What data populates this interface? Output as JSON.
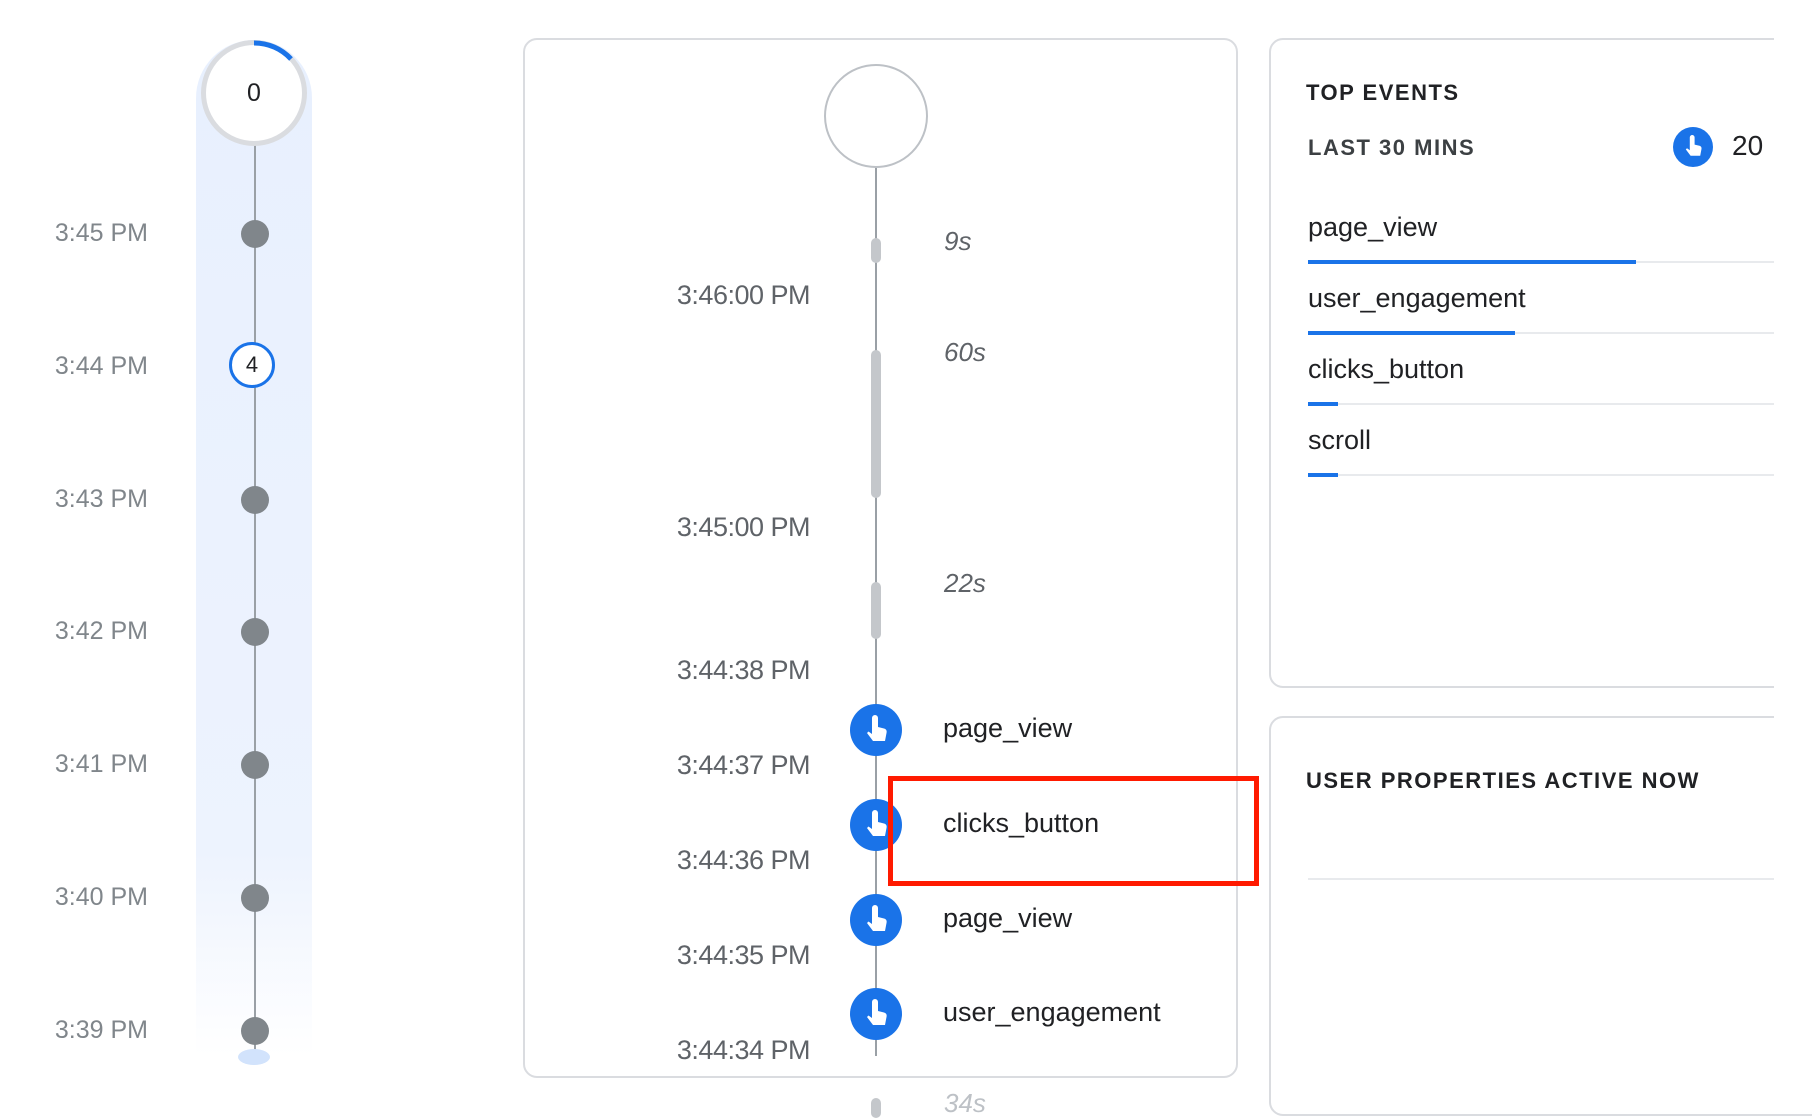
{
  "minute_timeline": {
    "current_count": "0",
    "rows": [
      {
        "time": "3:45 PM",
        "count": ""
      },
      {
        "time": "3:44 PM",
        "count": "4"
      },
      {
        "time": "3:43 PM",
        "count": ""
      },
      {
        "time": "3:42 PM",
        "count": ""
      },
      {
        "time": "3:41 PM",
        "count": ""
      },
      {
        "time": "3:40 PM",
        "count": ""
      },
      {
        "time": "3:39 PM",
        "count": ""
      }
    ]
  },
  "event_stream": {
    "gaps": [
      {
        "label": "9s"
      },
      {
        "label": "60s"
      },
      {
        "label": "22s"
      },
      {
        "label": "34s"
      }
    ],
    "timestamps": [
      "3:46:00 PM",
      "3:45:00 PM",
      "3:44:38 PM",
      "3:44:37 PM",
      "3:44:36 PM",
      "3:44:35 PM",
      "3:44:34 PM"
    ],
    "events": [
      {
        "name": "page_view",
        "icon": "touch-icon"
      },
      {
        "name": "clicks_button",
        "icon": "touch-icon",
        "highlighted": true
      },
      {
        "name": "page_view",
        "icon": "touch-icon"
      },
      {
        "name": "user_engagement",
        "icon": "touch-icon"
      }
    ]
  },
  "top_events": {
    "title": "TOP EVENTS",
    "subtitle": "LAST 30 MINS",
    "total_count": "20",
    "items": [
      {
        "name": "page_view",
        "share": 0.65
      },
      {
        "name": "user_engagement",
        "share": 0.41
      },
      {
        "name": "clicks_button",
        "share": 0.06
      },
      {
        "name": "scroll",
        "share": 0.06
      }
    ]
  },
  "user_properties": {
    "title": "USER PROPERTIES ACTIVE NOW"
  },
  "colors": {
    "accent": "#1a73e8",
    "highlight_box": "#ff1a00",
    "track_background": "#e8f0fe",
    "dot_gray": "#80868b"
  }
}
